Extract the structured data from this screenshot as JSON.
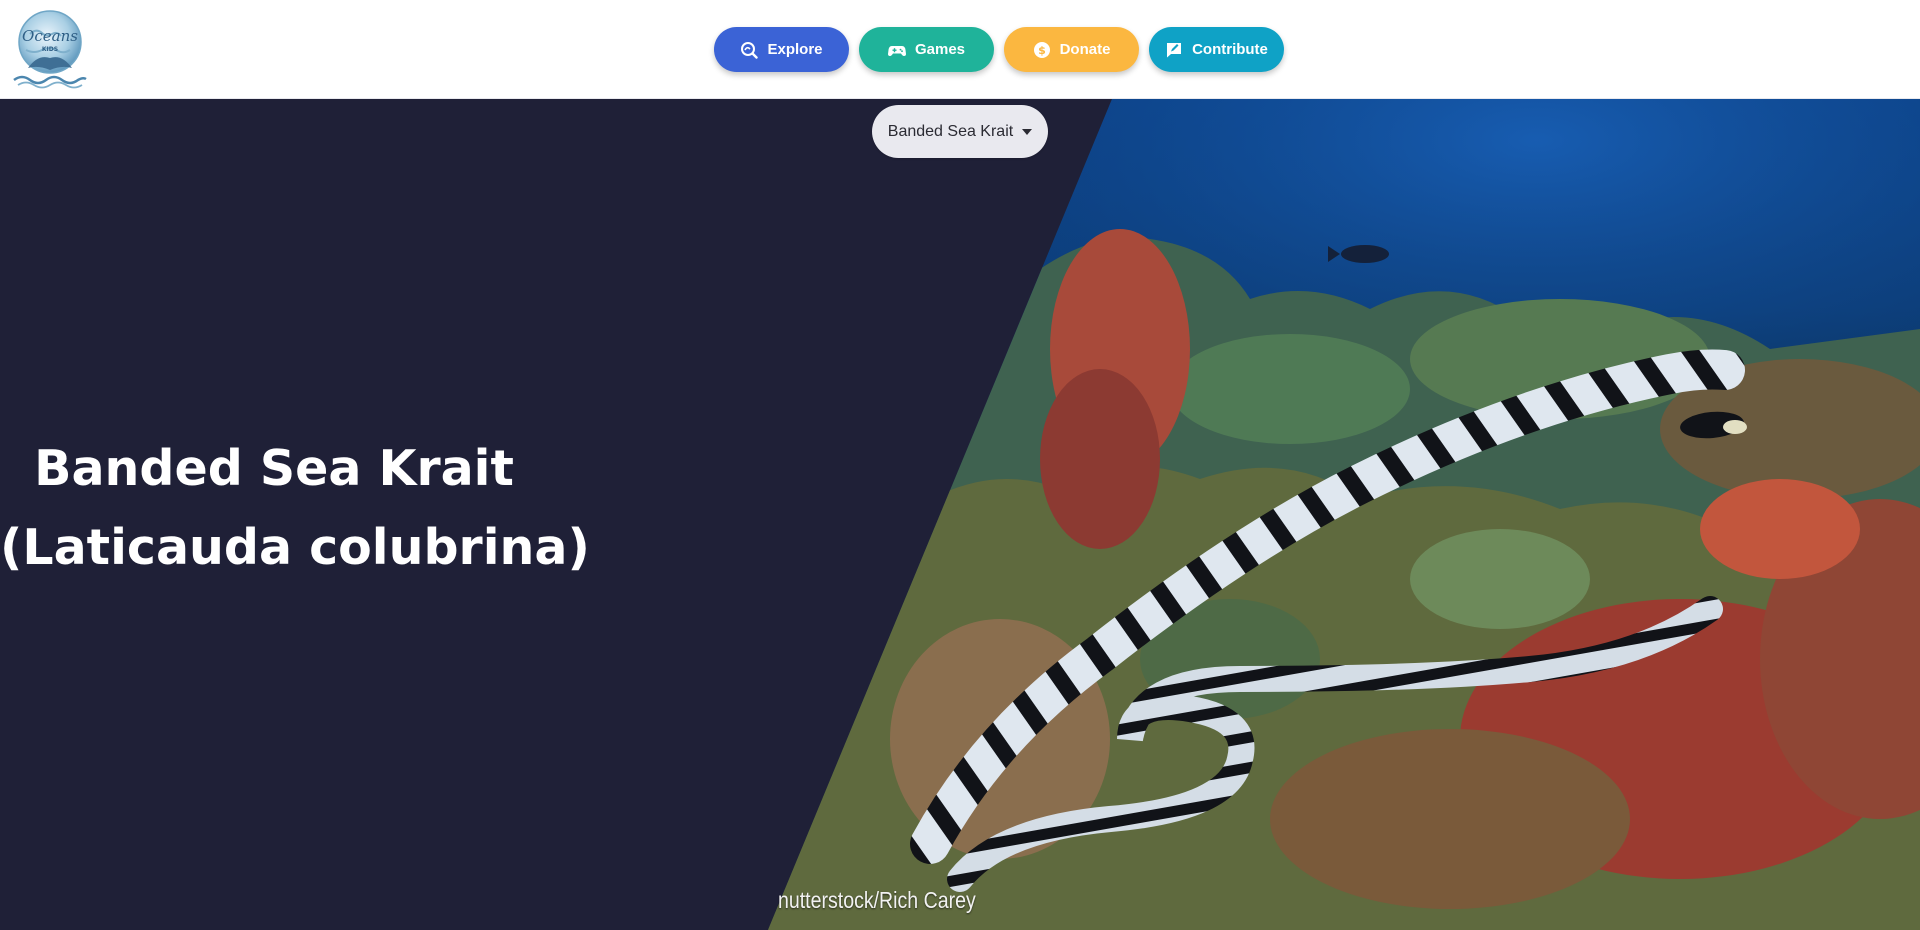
{
  "header": {
    "logo": {
      "text": "Oceans",
      "subtext": "KIDS",
      "icon": "whale-tail-globe-logo"
    },
    "nav": [
      {
        "label": "Explore",
        "icon": "explore-icon",
        "color": "#3b63d6"
      },
      {
        "label": "Games",
        "icon": "gamepad-icon",
        "color": "#1fb39a"
      },
      {
        "label": "Donate",
        "icon": "dollar-coin-icon",
        "color": "#fbb740"
      },
      {
        "label": "Contribute",
        "icon": "edit-message-icon",
        "color": "#0fa2c6"
      }
    ]
  },
  "hero": {
    "species_selector": {
      "selected": "Banded Sea Krait"
    },
    "title_common": "Banded Sea Krait",
    "title_scientific": "(Laticauda colubrina)",
    "photo_credit": "nutterstock/Rich Carey",
    "panel_color": "#1f2037"
  }
}
